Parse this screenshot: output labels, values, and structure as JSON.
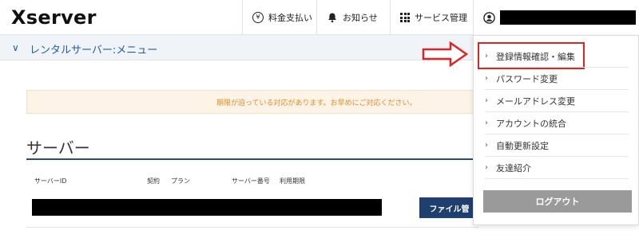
{
  "header": {
    "logo": "Xserver",
    "fee_label": "料金支払い",
    "fee_icon": "yen-icon",
    "news_label": "お知らせ",
    "news_icon": "bell-icon",
    "service_label": "サービス管理",
    "service_icon": "grid-icon",
    "user_icon": "user-icon"
  },
  "subbar": {
    "title": "レンタルサーバー:メニュー"
  },
  "notice": {
    "text": "期限が迫っている対応があります。お早めにご対応ください。"
  },
  "server_section": {
    "title": "サーバー",
    "columns": [
      "サーバーID",
      "契約",
      "プラン",
      "サーバー番号",
      "利用期限"
    ],
    "file_button": "ファイル管"
  },
  "dropdown": {
    "items": [
      {
        "label": "登録情報確認・編集"
      },
      {
        "label": "パスワード変更"
      },
      {
        "label": "メールアドレス変更"
      },
      {
        "label": "アカウントの統合"
      },
      {
        "label": "自動更新設定"
      },
      {
        "label": "友達紹介"
      }
    ],
    "logout": "ログアウト"
  },
  "colors": {
    "accent": "#1f5fa6",
    "highlight": "#e02424",
    "notice": "#e08b28",
    "button": "#1f3f6e"
  }
}
